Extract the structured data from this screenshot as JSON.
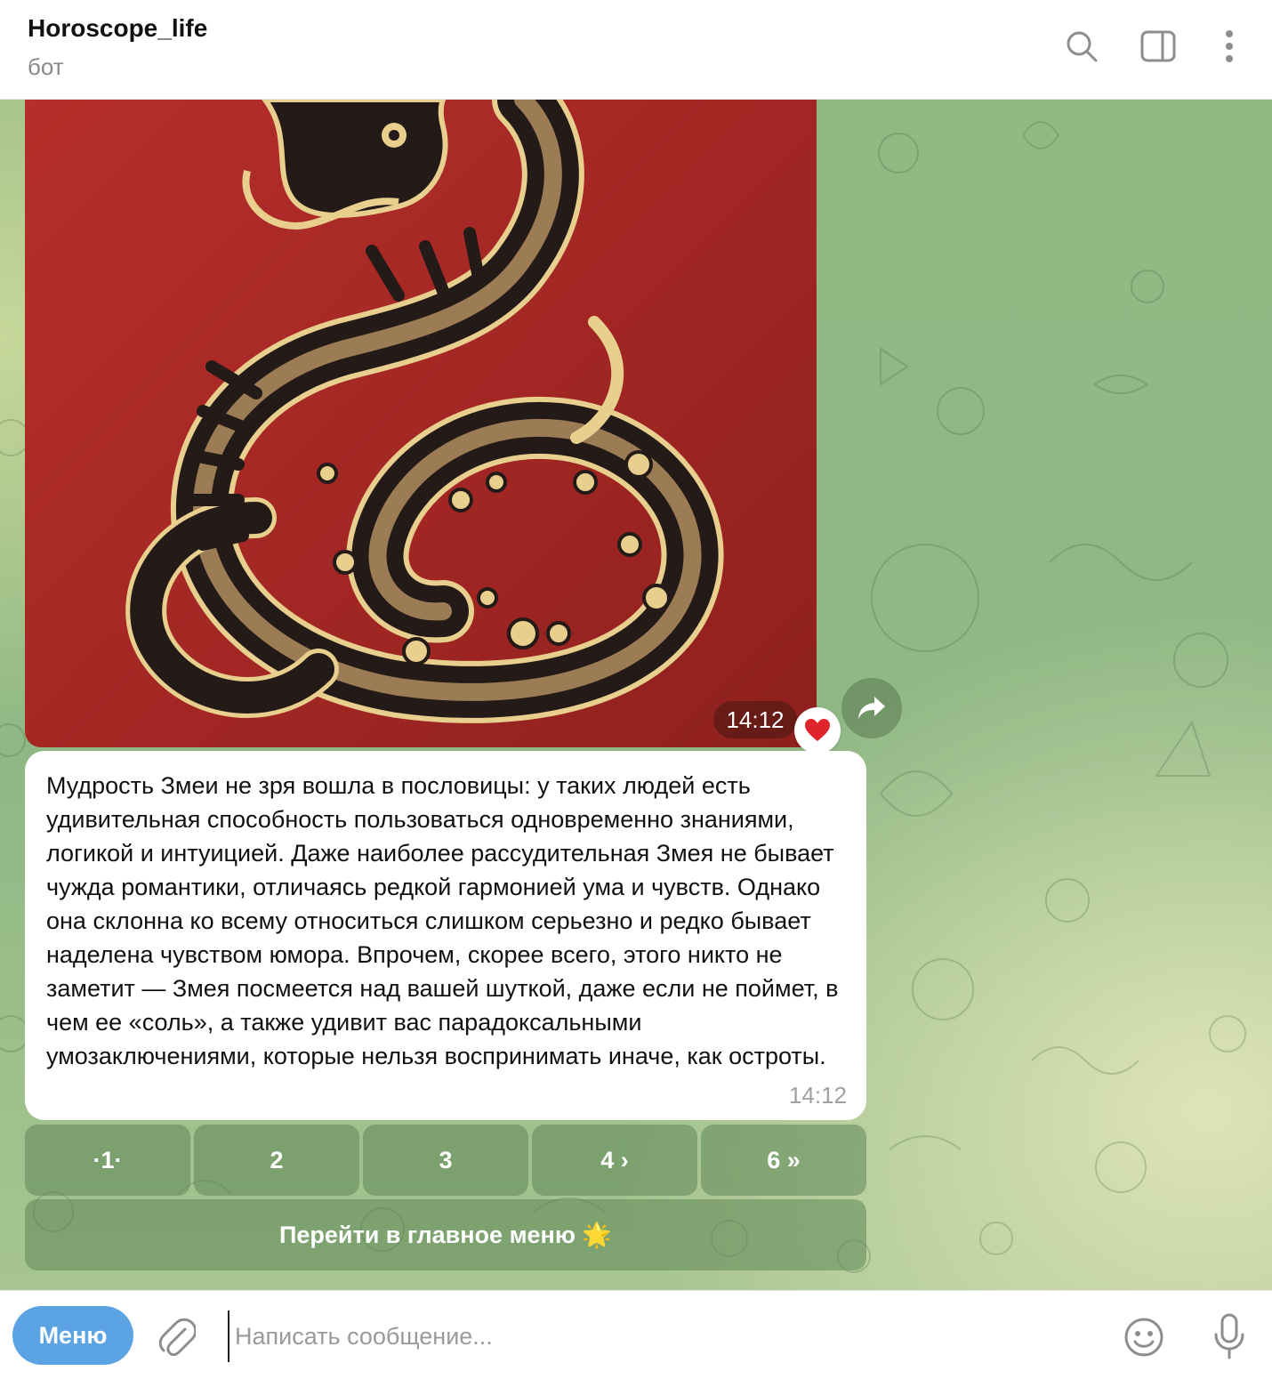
{
  "header": {
    "title": "Horoscope_life",
    "subtitle": "бот",
    "icons": [
      "search-icon",
      "sidebar-toggle-icon",
      "more-vertical-icon"
    ]
  },
  "photo_message": {
    "time": "14:12",
    "reaction": "❤️",
    "image": "snake-illustration"
  },
  "text_message": {
    "text": "Мудрость Змеи не зря вошла в пословицы: у таких людей есть удивительная способность пользоваться одновременно знаниями, логикой и интуицией. Даже наиболее рассудительная Змея не бывает чужда романтики, отличаясь редкой гармонией ума и чувств. Однако она склонна ко всему относиться слишком серьезно и редко бывает наделена чувством юмора. Впрочем, скорее всего, этого никто не заметит — Змея посмеется над вашей шуткой, даже если не поймет, в чем ее «соль», а также удивит вас парадоксальными умозаключениями, которые нельзя воспринимать иначе, как остроты.",
    "time": "14:12"
  },
  "keyboard": {
    "pages": [
      "·1·",
      "2",
      "3",
      "4 ›",
      "6 »"
    ],
    "main_menu": "Перейти в главное меню 🌟"
  },
  "composer": {
    "menu_label": "Меню",
    "placeholder": "Написать сообщение...",
    "icons": [
      "attach-icon",
      "emoji-icon",
      "microphone-icon"
    ]
  },
  "colors": {
    "accent": "#5ba3e3",
    "photo_bg": "#a5282a",
    "keyboard_button": "#6f9a66"
  }
}
